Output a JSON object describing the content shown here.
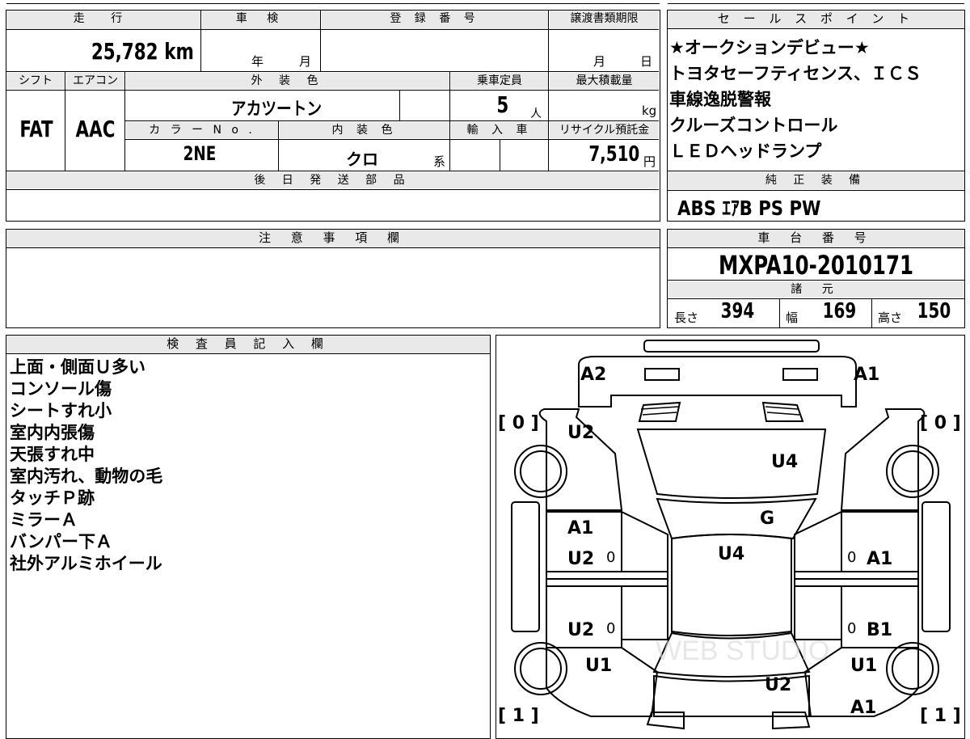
{
  "sheet": {
    "mileage_header": "走 行",
    "mileage_value": "25,782",
    "mileage_unit": "km",
    "shaken_header": "車 検",
    "shaken_year": "年",
    "shaken_month": "月",
    "reg_header": "登 録 番 号",
    "transfer_header": "譲渡書類期限",
    "transfer_month": "月",
    "transfer_day": "日",
    "shift_header": "シフト",
    "aircon_header": "エアコン",
    "ext_color_header": "外 装 色",
    "capacity_header": "乗車定員",
    "max_load_header": "最大積載量",
    "shift_value": "FAT",
    "aircon_value": "AAC",
    "ext_color_value": "アカツートン",
    "capacity_value": "5",
    "capacity_unit": "人",
    "max_load_unit": "kg",
    "color_no_header": "カ ラ ー N o .",
    "int_color_header": "内 装 色",
    "import_header": "輸 入 車",
    "recycle_header": "リサイクル預託金",
    "color_no_value": "2NE",
    "int_color_value": "クロ",
    "int_color_suffix": "系",
    "recycle_value": "7,510",
    "recycle_unit": "円",
    "later_parts_header": "後 日 発 送 部 品"
  },
  "sales": {
    "header": "セ ー ル ス ポ イ ン ト",
    "points": [
      "★オークションデビュー★",
      "トヨタセーフティセンス、ＩＣＳ",
      "車線逸脱警報",
      "クルーズコントロール",
      "ＬＥＤヘッドランプ"
    ],
    "equip_header": "純 正 装 備",
    "equip_value": "ABS ｴｱB PS PW"
  },
  "notes": {
    "header": "注 意 事 項 欄"
  },
  "chassis": {
    "header": "車 台 番 号",
    "value": "MXPA10-2010171",
    "spec_header": "諸 元",
    "length_label": "長さ",
    "length_value": "394",
    "width_label": "幅",
    "width_value": "169",
    "height_label": "高さ",
    "height_value": "150"
  },
  "inspector": {
    "header": "検 査 員 記 入 欄",
    "lines": [
      "上面・側面Ｕ多い",
      "コンソール傷",
      "シートすれ小",
      "室内内張傷",
      "天張すれ中",
      "室内汚れ、動物の毛",
      "タッチＰ跡",
      "ミラーＡ",
      "バンパー下Ａ",
      "社外アルミホイール"
    ]
  },
  "diagram": {
    "labels": {
      "front_left": "A2",
      "front_right": "A1",
      "bracket_tl": "[ 0 ]",
      "bracket_tr": "[ 0 ]",
      "bracket_bl": "[ 1 ]",
      "bracket_br": "[ 1 ]",
      "left_fender": "U2",
      "hood": "U4",
      "windshield": "G",
      "roof": "U4",
      "left_front_door_a": "A1",
      "left_front_door_u": "U2",
      "left_rear_door": "U2",
      "left_rear_fender": "U1",
      "right_front_door": "A1",
      "right_rear_door": "B1",
      "right_rear_fender": "U1",
      "tailgate": "U2",
      "rear_right": "A1",
      "zero_mark": "0"
    },
    "watermark": "WEB STUDIO"
  }
}
